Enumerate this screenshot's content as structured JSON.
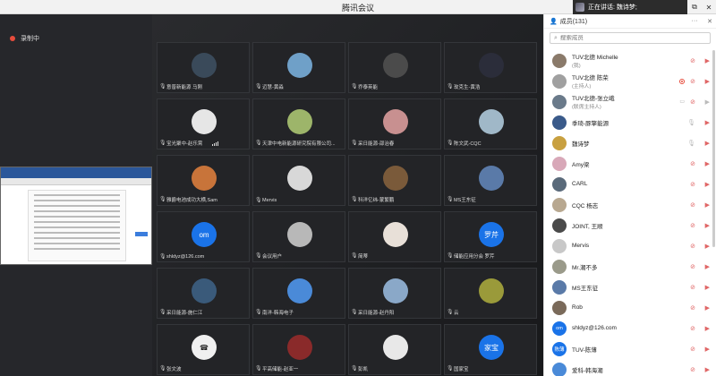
{
  "window": {
    "title": "腾讯会议",
    "speaking_label": "正在讲话: 魏诗梦;",
    "controls": [
      "⧉",
      "✕"
    ]
  },
  "left": {
    "recording_label": "录制中"
  },
  "grid": {
    "tiles": [
      {
        "name": "意普新能源 马刚",
        "avatar_color": "#3a4a5a",
        "avatar_text": ""
      },
      {
        "name": "迈慧-黄淼",
        "avatar_color": "#6fa0c8",
        "avatar_text": ""
      },
      {
        "name": "乔泰英能",
        "avatar_color": "#4b4b4b",
        "avatar_text": ""
      },
      {
        "name": "玫克生-黄浩",
        "avatar_color": "#2b2d3a",
        "avatar_text": ""
      },
      {
        "name": "宝光聚中-赵乐霄",
        "avatar_color": "#e6e6e6",
        "avatar_text": "",
        "signal": true
      },
      {
        "name": "天津中电新能源研究院有限公司...",
        "avatar_color": "#9db56a",
        "avatar_text": ""
      },
      {
        "name": "采日能源-邵治春",
        "avatar_color": "#c89090",
        "avatar_text": ""
      },
      {
        "name": "陈文武-CQC",
        "avatar_color": "#a0b8c8",
        "avatar_text": ""
      },
      {
        "name": "雅爵电池成功大横,Sam",
        "avatar_color": "#c8743a",
        "avatar_text": ""
      },
      {
        "name": "Mervis",
        "avatar_color": "#d8d8d8",
        "avatar_text": ""
      },
      {
        "name": "科洋亿纬-蒙繁鹏",
        "avatar_color": "#7a5a3a",
        "avatar_text": ""
      },
      {
        "name": "MS王东征",
        "avatar_color": "#5a7aa8",
        "avatar_text": ""
      },
      {
        "name": "shldyz@126.com",
        "avatar_color": "#1a73e8",
        "avatar_text": "om"
      },
      {
        "name": "会议用户",
        "avatar_color": "#b8b8b8",
        "avatar_text": ""
      },
      {
        "name": "简蒂",
        "avatar_color": "#e8e0d8",
        "avatar_text": ""
      },
      {
        "name": "储能应用分会 罗芹",
        "avatar_color": "#1a73e8",
        "avatar_text": "罗芹"
      },
      {
        "name": "采日能源-施仁江",
        "avatar_color": "#3a5a7a",
        "avatar_text": ""
      },
      {
        "name": "南洋-韩海电子",
        "avatar_color": "#4a8ad8",
        "avatar_text": ""
      },
      {
        "name": "采日能源-赵丹阳",
        "avatar_color": "#8aa8c8",
        "avatar_text": ""
      },
      {
        "name": "云",
        "avatar_color": "#9a9a3a",
        "avatar_text": ""
      },
      {
        "name": "张文波",
        "avatar_color": "#f0f0f0",
        "avatar_text": "☎"
      },
      {
        "name": "平高储能-赵亚一",
        "avatar_color": "#8a2a2a",
        "avatar_text": ""
      },
      {
        "name": "彭凯",
        "avatar_color": "#e8e8e8",
        "avatar_text": ""
      },
      {
        "name": "国家宝",
        "avatar_color": "#1a73e8",
        "avatar_text": "家宝"
      }
    ]
  },
  "panel": {
    "header": "成员(131)",
    "header_controls": [
      "···",
      "✕"
    ],
    "search_placeholder": "搜索成员",
    "members": [
      {
        "name": "TUV北德 Michelle",
        "role": "(我)",
        "avatar_color": "#8a7a6a",
        "avatar_text": "",
        "mic": "muted",
        "cam": "muted"
      },
      {
        "name": "TUV北德 陈荣",
        "role": "(主持人)",
        "avatar_color": "#a0a0a0",
        "avatar_text": "",
        "mic": "muted",
        "cam": "muted",
        "rec": true
      },
      {
        "name": "TUV北德-张立峨",
        "role": "(联席主持人)",
        "avatar_color": "#6a7a8a",
        "avatar_text": "",
        "mic": "muted",
        "cam": "dim",
        "mon": true
      },
      {
        "name": "季琦-豚擎能源",
        "role": "",
        "avatar_color": "#3a5a8a",
        "avatar_text": "",
        "mic": "dim",
        "cam": "muted"
      },
      {
        "name": "魏诗梦",
        "role": "",
        "avatar_color": "#c8a040",
        "avatar_text": "",
        "mic": "dim",
        "cam": "muted"
      },
      {
        "name": "Amy梁",
        "role": "",
        "avatar_color": "#d8a8b8",
        "avatar_text": "",
        "mic": "muted",
        "cam": "muted"
      },
      {
        "name": "CARL",
        "role": "",
        "avatar_color": "#5a6a7a",
        "avatar_text": "",
        "mic": "muted",
        "cam": "muted"
      },
      {
        "name": "CQC 杨志",
        "role": "",
        "avatar_color": "#b8a890",
        "avatar_text": "",
        "mic": "muted",
        "cam": "muted"
      },
      {
        "name": "JOINT, 王顺",
        "role": "",
        "avatar_color": "#4a4a4a",
        "avatar_text": "",
        "mic": "muted",
        "cam": "muted"
      },
      {
        "name": "Mervis",
        "role": "",
        "avatar_color": "#c8c8c8",
        "avatar_text": "",
        "mic": "muted",
        "cam": "muted"
      },
      {
        "name": "Mr.潮不多",
        "role": "",
        "avatar_color": "#9a9a8a",
        "avatar_text": "",
        "mic": "muted",
        "cam": "muted"
      },
      {
        "name": "MS王东征",
        "role": "",
        "avatar_color": "#5a7aa8",
        "avatar_text": "",
        "mic": "muted",
        "cam": "muted"
      },
      {
        "name": "Rob",
        "role": "",
        "avatar_color": "#7a6a5a",
        "avatar_text": "",
        "mic": "muted",
        "cam": "muted"
      },
      {
        "name": "shldyz@126.com",
        "role": "",
        "avatar_color": "#1a73e8",
        "avatar_text": "om",
        "mic": "muted",
        "cam": "muted"
      },
      {
        "name": "TUV-陈薄",
        "role": "",
        "avatar_color": "#1a73e8",
        "avatar_text": "陈薄",
        "mic": "muted",
        "cam": "muted"
      },
      {
        "name": "爱科-韩海潮",
        "role": "",
        "avatar_color": "#4a8ad8",
        "avatar_text": "",
        "mic": "muted",
        "cam": "muted"
      }
    ]
  }
}
